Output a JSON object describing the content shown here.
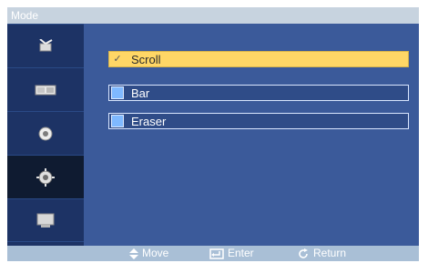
{
  "window": {
    "title": "Mode"
  },
  "sidebar": {
    "items": [
      {
        "icon": "antenna-icon",
        "active": false
      },
      {
        "icon": "picture-icon",
        "active": false
      },
      {
        "icon": "sound-icon",
        "active": false
      },
      {
        "icon": "setup-gear-icon",
        "active": true
      },
      {
        "icon": "input-icon",
        "active": false
      }
    ]
  },
  "options": [
    {
      "label": "Scroll",
      "selected": true,
      "mark": "✓"
    },
    {
      "label": "Bar",
      "selected": false
    },
    {
      "label": "Eraser",
      "selected": false
    }
  ],
  "footer": {
    "move_label": "Move",
    "enter_label": "Enter",
    "return_label": "Return"
  },
  "colors": {
    "frame_bg": "#2f4c88",
    "sidebar_bg": "#1d3365",
    "selected_bg": "#ffd766",
    "option_mark": "#7fb9ff",
    "footer_bg": "#a9bfd6"
  }
}
